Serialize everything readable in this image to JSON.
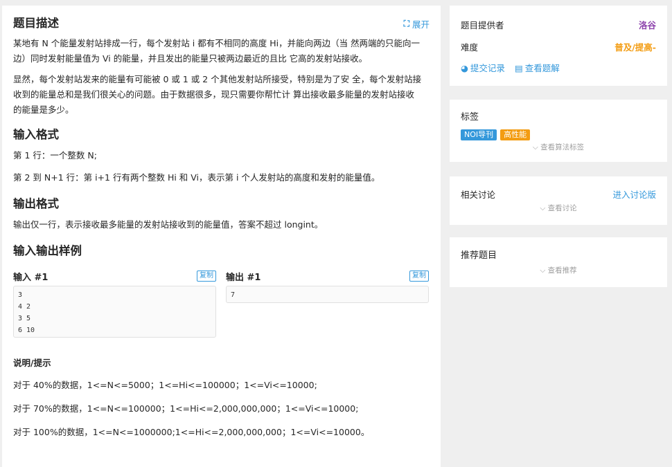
{
  "problem": {
    "desc_title": "题目描述",
    "expand_label": "展开",
    "desc_p1_line1": "某地有 N 个能量发射站排成一行，每个发射站 i 都有不相同的高度 Hi，并能向两边（当 然两端的只能向一",
    "desc_p1_line2": "边）同时发射能量值为 Vi 的能量，并且发出的能量只被两边最近的且比 它高的发射站接收。",
    "desc_p2_line1": "显然，每个发射站发来的能量有可能被 0 或 1 或 2 个其他发射站所接受，特别是为了安 全，每个发射站接",
    "desc_p2_line2": "收到的能量总和是我们很关心的问题。由于数据很多，现只需要你帮忙计 算出接收最多能量的发射站接收",
    "desc_p2_line3": "的能量是多少。",
    "input_title": "输入格式",
    "input_p1": "第 1 行：一个整数 N;",
    "input_p2": "第 2 到 N+1 行：第 i+1 行有两个整数 Hi 和 Vi，表示第 i 个人发射站的高度和发射的能量值。",
    "output_title": "输出格式",
    "output_p1": "输出仅一行，表示接收最多能量的发射站接收到的能量值，答案不超过 longint。",
    "samples_title": "输入输出样例",
    "input_label": "输入 #1",
    "output_label": "输出 #1",
    "copy_label": "复制",
    "sample_input": "3\n4 2\n3 5\n6 10",
    "sample_output": "7",
    "hint_title": "说明/提示",
    "hint_1": "对于 40%的数据，1<=N<=5000；1<=Hi<=100000；1<=Vi<=10000;",
    "hint_2": "对于 70%的数据，1<=N<=100000；1<=Hi<=2,000,000,000；1<=Vi<=10000;",
    "hint_3": "对于 100%的数据，1<=N<=1000000;1<=Hi<=2,000,000,000；1<=Vi<=10000。"
  },
  "sidebar": {
    "provider_label": "题目提供者",
    "provider_value": "洛谷",
    "difficulty_label": "难度",
    "difficulty_value": "普及/提高-",
    "submissions_label": "提交记录",
    "solutions_label": "查看题解",
    "tags_title": "标签",
    "tags": [
      {
        "label": "NOI导刊",
        "color": "#3498db"
      },
      {
        "label": "高性能",
        "color": "#f39c12"
      }
    ],
    "show_tags_label": "查看算法标签",
    "discuss_title": "相关讨论",
    "discuss_link": "进入讨论版",
    "show_discuss_label": "查看讨论",
    "recommend_title": "推荐题目",
    "show_recommend_label": "查看推荐"
  },
  "colors": {
    "accent": "#3498db",
    "provider": "#8e44ad",
    "difficulty": "#f39c12"
  },
  "icons": {
    "expand": "expand-icon",
    "submissions": "pie-chart-icon",
    "solutions": "book-icon",
    "more": "chevron-down-icon"
  }
}
